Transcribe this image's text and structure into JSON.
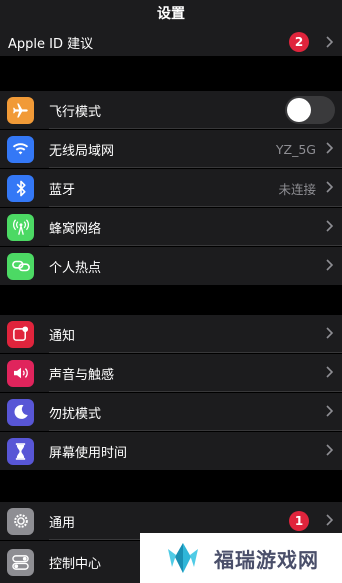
{
  "header": {
    "title": "设置"
  },
  "apple_id_row": {
    "label": "Apple ID 建议",
    "badge": "2"
  },
  "group1": {
    "airplane": {
      "label": "飞行模式",
      "toggle_on": false,
      "icon": "airplane-icon",
      "color": "#f19a37"
    },
    "wifi": {
      "label": "无线局域网",
      "value": "YZ_5G",
      "icon": "wifi-icon",
      "color": "#3478f6"
    },
    "bluetooth": {
      "label": "蓝牙",
      "value": "未连接",
      "icon": "bluetooth-icon",
      "color": "#3478f6"
    },
    "cellular": {
      "label": "蜂窝网络",
      "icon": "antenna-icon",
      "color": "#4cd964"
    },
    "hotspot": {
      "label": "个人热点",
      "icon": "link-icon",
      "color": "#4cd964"
    }
  },
  "group2": {
    "notifications": {
      "label": "通知",
      "icon": "notification-icon",
      "color": "#e0243c"
    },
    "sounds": {
      "label": "声音与触感",
      "icon": "speaker-icon",
      "color": "#e0245c"
    },
    "dnd": {
      "label": "勿扰模式",
      "icon": "moon-icon",
      "color": "#5856d6"
    },
    "screentime": {
      "label": "屏幕使用时间",
      "icon": "hourglass-icon",
      "color": "#5856d6"
    }
  },
  "group3": {
    "general": {
      "label": "通用",
      "badge": "1",
      "icon": "gear-icon",
      "color": "#8e8e93"
    },
    "control_center": {
      "label": "控制中心",
      "icon": "toggles-icon",
      "color": "#8e8e93"
    }
  },
  "watermark": {
    "text": "福瑞游戏网"
  }
}
